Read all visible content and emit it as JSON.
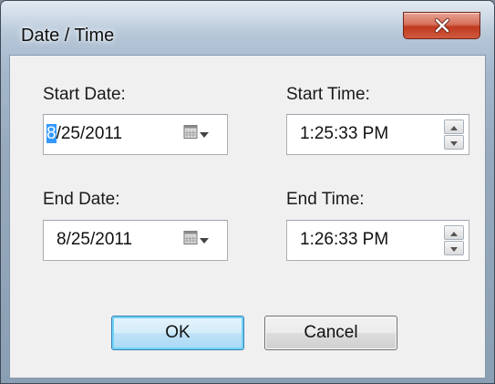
{
  "window": {
    "title": "Date / Time",
    "close_symbol": "X"
  },
  "start_date": {
    "label": "Start Date:",
    "selected_part": "8",
    "rest": "/25/2011"
  },
  "start_time": {
    "label": "Start Time:",
    "value": "1:25:33 PM"
  },
  "end_date": {
    "label": "End Date:",
    "value": "8/25/2011"
  },
  "end_time": {
    "label": "End Time:",
    "value": "1:26:33 PM"
  },
  "buttons": {
    "ok": "OK",
    "cancel": "Cancel"
  },
  "icons": {
    "close": "close-icon",
    "calendar": "calendar-icon",
    "dropdown": "chevron-down-icon",
    "spin_up": "spin-up-icon",
    "spin_down": "spin-down-icon"
  },
  "colors": {
    "selection": "#3399ff",
    "close_button": "#c0391f",
    "default_button_border": "#3c7fb1"
  }
}
